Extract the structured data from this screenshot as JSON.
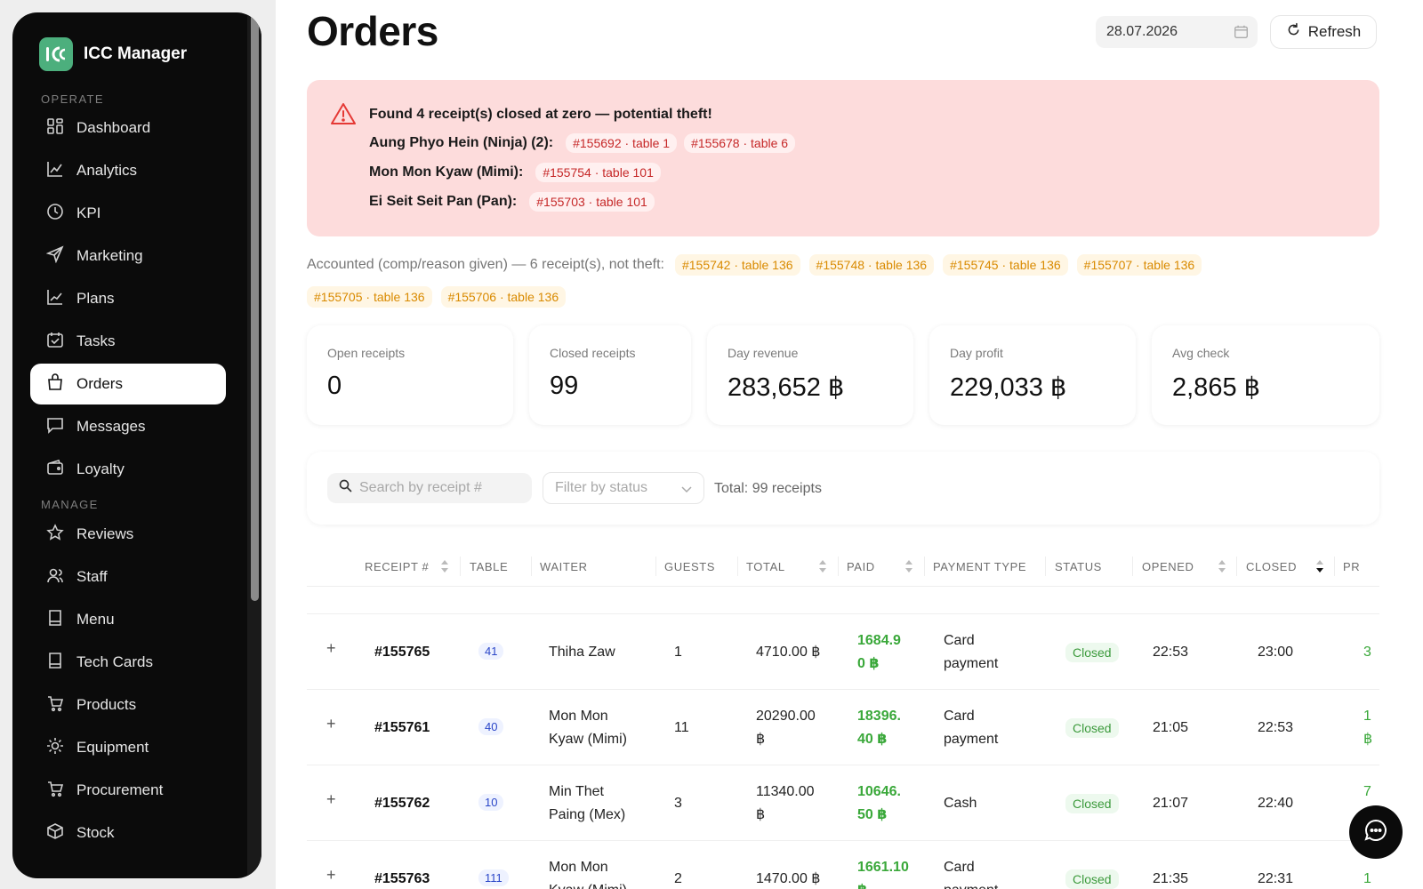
{
  "app": {
    "name": "ICC Manager"
  },
  "sidebar": {
    "sections": [
      "OPERATE",
      "MANAGE"
    ],
    "items": [
      {
        "label": "Dashboard",
        "icon": "dashboard-icon"
      },
      {
        "label": "Analytics",
        "icon": "analytics-icon"
      },
      {
        "label": "KPI",
        "icon": "kpi-icon"
      },
      {
        "label": "Marketing",
        "icon": "marketing-icon"
      },
      {
        "label": "Plans",
        "icon": "plans-icon"
      },
      {
        "label": "Tasks",
        "icon": "tasks-icon"
      },
      {
        "label": "Orders",
        "icon": "orders-icon",
        "active": true
      },
      {
        "label": "Messages",
        "icon": "messages-icon"
      },
      {
        "label": "Loyalty",
        "icon": "loyalty-icon"
      },
      {
        "label": "Reviews",
        "icon": "reviews-icon"
      },
      {
        "label": "Staff",
        "icon": "staff-icon"
      },
      {
        "label": "Menu",
        "icon": "menu-icon"
      },
      {
        "label": "Tech Cards",
        "icon": "tech-cards-icon"
      },
      {
        "label": "Products",
        "icon": "products-icon"
      },
      {
        "label": "Equipment",
        "icon": "equipment-icon"
      },
      {
        "label": "Procurement",
        "icon": "procurement-icon"
      },
      {
        "label": "Stock",
        "icon": "stock-icon"
      }
    ]
  },
  "header": {
    "title": "Orders",
    "date": "28.07.2026",
    "refresh_label": "Refresh"
  },
  "alert": {
    "title": "Found 4 receipt(s) closed at zero — potential theft!",
    "rows": [
      {
        "who": "Aung Phyo Hein (Ninja) (2):",
        "chips": [
          "#155692 · table 1",
          "#155678 · table 6"
        ]
      },
      {
        "who": "Mon Mon Kyaw (Mimi):",
        "chips": [
          "#155754 · table 101"
        ]
      },
      {
        "who": "Ei Seit Seit Pan (Pan):",
        "chips": [
          "#155703 · table 101"
        ]
      }
    ]
  },
  "accounted": {
    "text": "Accounted (comp/reason given) — 6 receipt(s), not theft:",
    "chips": [
      "#155742 · table 136",
      "#155748 · table 136",
      "#155745 · table 136",
      "#155707 · table 136",
      "#155705 · table 136",
      "#155706 · table 136"
    ]
  },
  "stats": [
    {
      "label": "Open receipts",
      "value": "0"
    },
    {
      "label": "Closed receipts",
      "value": "99"
    },
    {
      "label": "Day revenue",
      "value": "283,652 ฿"
    },
    {
      "label": "Day profit",
      "value": "229,033 ฿"
    },
    {
      "label": "Avg check",
      "value": "2,865 ฿"
    }
  ],
  "filters": {
    "search_placeholder": "Search by receipt #",
    "status_placeholder": "Filter by status",
    "total": "Total: 99 receipts"
  },
  "table": {
    "columns": [
      "RECEIPT #",
      "TABLE",
      "WAITER",
      "GUESTS",
      "TOTAL",
      "PAID",
      "PAYMENT TYPE",
      "STATUS",
      "OPENED",
      "CLOSED",
      "PR"
    ],
    "rows": [
      {
        "expand": "+",
        "receipt": "#155765",
        "table": "41",
        "waiter": [
          "Thiha Zaw"
        ],
        "guests": "1",
        "total": [
          "4710.00 ฿"
        ],
        "paid": [
          "1684.9",
          "0 ฿"
        ],
        "payment": [
          "Card",
          "payment"
        ],
        "status": "Closed",
        "opened": "22:53",
        "closed": "23:00",
        "pr": [
          "3"
        ]
      },
      {
        "expand": "+",
        "receipt": "#155761",
        "table": "40",
        "waiter": [
          "Mon Mon",
          "Kyaw (Mimi)"
        ],
        "guests": "11",
        "total": [
          "20290.00",
          "฿"
        ],
        "paid": [
          "18396.",
          "40 ฿"
        ],
        "payment": [
          "Card",
          "payment"
        ],
        "status": "Closed",
        "opened": "21:05",
        "closed": "22:53",
        "pr": [
          "1",
          "฿"
        ]
      },
      {
        "expand": "+",
        "receipt": "#155762",
        "table": "10",
        "waiter": [
          "Min Thet",
          "Paing (Mex)"
        ],
        "guests": "3",
        "total": [
          "11340.00",
          "฿"
        ],
        "paid": [
          "10646.",
          "50 ฿"
        ],
        "payment": [
          "Cash"
        ],
        "status": "Closed",
        "opened": "21:07",
        "closed": "22:40",
        "pr": [
          "7",
          "฿"
        ]
      },
      {
        "expand": "+",
        "receipt": "#155763",
        "table": "111",
        "waiter": [
          "Mon Mon",
          "Kyaw (Mimi)"
        ],
        "guests": "2",
        "total": [
          "1470.00 ฿"
        ],
        "paid": [
          "1661.10",
          "฿"
        ],
        "payment": [
          "Card",
          "payment"
        ],
        "status": "Closed",
        "opened": "21:35",
        "closed": "22:31",
        "pr": [
          "1"
        ]
      }
    ]
  },
  "colors": {
    "accent": "#4caf7d",
    "alert_bg": "#fddcdc",
    "alert_text": "#c62828",
    "amber": "#d98a00",
    "paid_green": "#3aa83a"
  }
}
